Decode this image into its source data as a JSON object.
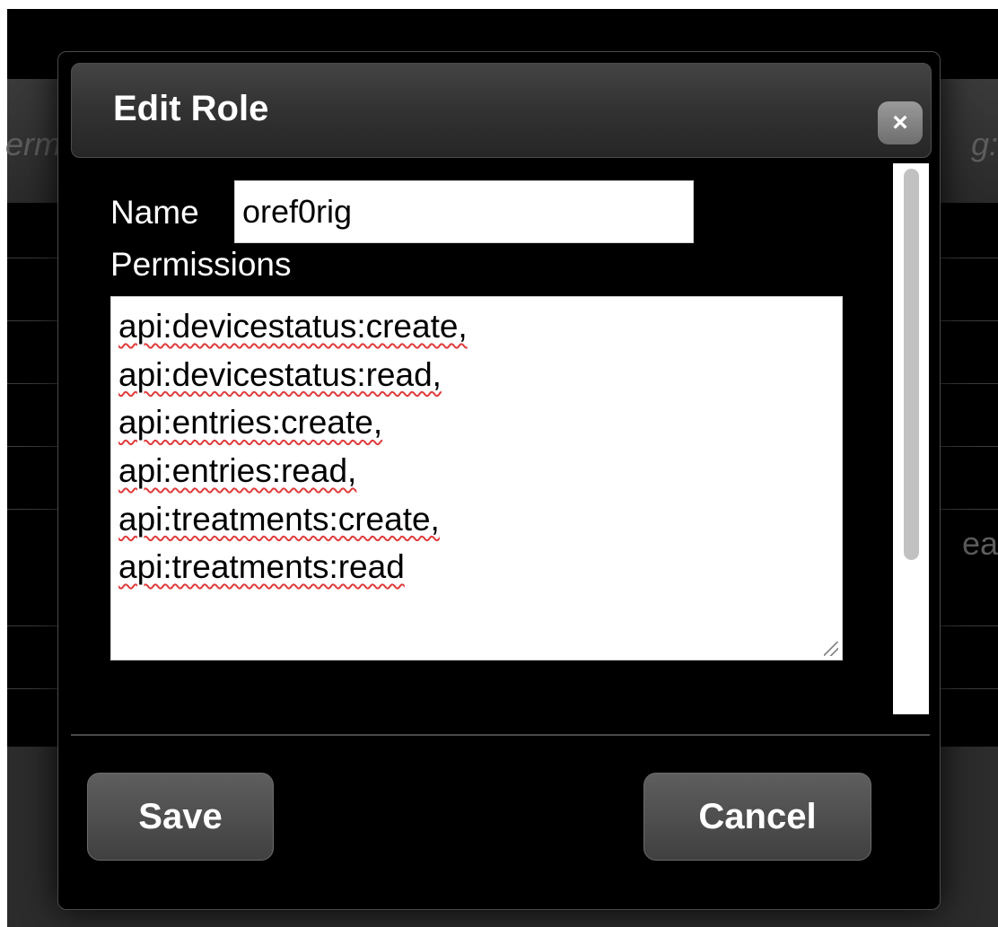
{
  "background": {
    "left_fragment": "erm",
    "right_fragment": "g:",
    "mid_fragment": "ea"
  },
  "dialog": {
    "title": "Edit Role",
    "close_icon": "close-icon",
    "name_label": "Name",
    "name_value": "oref0rig",
    "permissions_label": "Permissions",
    "permissions": [
      "api:devicestatus:create,",
      "api:devicestatus:read,",
      "api:entries:create,",
      "api:entries:read,",
      "api:treatments:create,",
      "api:treatments:read"
    ],
    "save_label": "Save",
    "cancel_label": "Cancel",
    "close_symbol": "×"
  },
  "colors": {
    "dialog_bg": "#000000",
    "button_bg": "#4f4f4f",
    "spellcheck_underline": "#e03c3c"
  }
}
